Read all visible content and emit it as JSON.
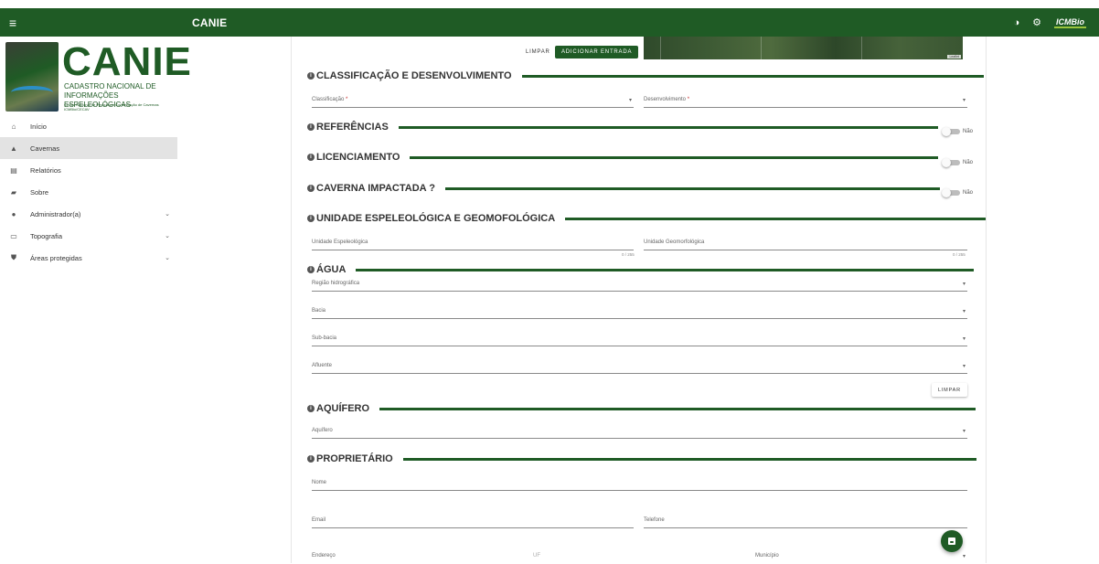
{
  "topbar": {
    "menu_icon": "≡",
    "title": "CANIE",
    "icons": [
      "contrast-icon",
      "user-settings-icon"
    ],
    "brand": "ICMBio"
  },
  "sidebar": {
    "logo": {
      "word": "CANIE",
      "line1": "CADASTRO NACIONAL DE",
      "line2": "INFORMAÇÕES ESPELEOLÓGICAS",
      "line3": "Centro Nacional de Pesquisa e Conservação de Cavernas ICMBio/CECAV"
    },
    "items": [
      {
        "label": "Início",
        "icon": "home-icon",
        "glyph": "⌂"
      },
      {
        "label": "Cavernas",
        "icon": "mountain-icon",
        "glyph": "▲"
      },
      {
        "label": "Relatórios",
        "icon": "report-icon",
        "glyph": "▤"
      },
      {
        "label": "Sobre",
        "icon": "chat-icon",
        "glyph": "▰"
      },
      {
        "label": "Administrador(a)",
        "icon": "person-icon",
        "glyph": "●"
      },
      {
        "label": "Topografia",
        "icon": "folder-icon",
        "glyph": "▭"
      },
      {
        "label": "Áreas protegidas",
        "icon": "shield-icon",
        "glyph": "⛊"
      }
    ],
    "active_index": 1
  },
  "main": {
    "actions": {
      "clear": "LIMPAR",
      "add_entry": "ADICIONAR ENTRADA"
    },
    "map_attribution": "Leaflet",
    "sections": {
      "classificacao": "CLASSIFICAÇÃO E DESENVOLVIMENTO",
      "referencias": "REFERÊNCIAS",
      "licenciamento": "LICENCIAMENTO",
      "impactada": "CAVERNA IMPACTADA ?",
      "unidade": "UNIDADE ESPELEOLÓGICA E GEOMOFOLÓGICA",
      "agua": "ÁGUA",
      "aquifero": "AQUÍFERO",
      "proprietario": "PROPRIETÁRIO"
    },
    "fields": {
      "classificacao": "Classificação",
      "desenvolvimento": "Desenvolvimento",
      "required_mark": "*",
      "unidade_espeleologica": "Unidade Espeleológica",
      "unidade_geomorfologica": "Unidade Geomorfológica",
      "counter": "0 / 255",
      "regiao": "Região hidrográfica",
      "bacia": "Bacia",
      "subbacia": "Sub-bacia",
      "afluente": "Afluente",
      "aquifero": "Aquífero",
      "nome": "Nome",
      "email": "Email",
      "telefone": "Telefone",
      "endereco": "Endereço",
      "uf": "UF",
      "municipio": "Município"
    },
    "toggles": {
      "off_label": "Não"
    },
    "agua_clear": "LIMPAR",
    "info_glyph": "i",
    "caret": "▾"
  },
  "fab": {
    "icon": "save-icon"
  }
}
